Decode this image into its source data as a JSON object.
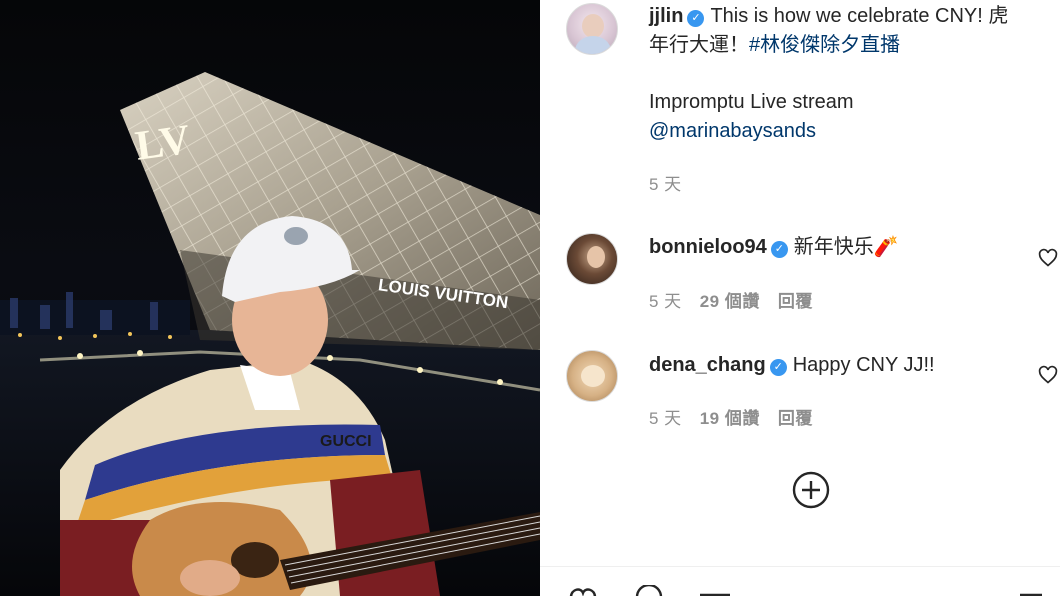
{
  "post": {
    "author": "jjlin",
    "caption_line1": "This is how we celebrate CNY! 虎",
    "caption_line2_text": "年行大運！",
    "caption_hashtag": "#林俊傑除夕直播",
    "caption_line3": "Impromptu Live stream",
    "caption_mention": "@marinabaysands",
    "age": "5 天"
  },
  "photo": {
    "building_sign": "LOUIS VUITTON",
    "jacket_logo": "GUCCI"
  },
  "comments": [
    {
      "username": "bonnieloo94",
      "text": "新年快乐🧨",
      "age": "5 天",
      "likes": "29 個讚",
      "reply": "回覆"
    },
    {
      "username": "dena_chang",
      "text": "Happy CNY JJ!!",
      "age": "5 天",
      "likes": "19 個讚",
      "reply": "回覆"
    }
  ],
  "icons": {
    "verified": "verified-badge-icon",
    "like": "heart-icon",
    "load_more": "plus-circle-icon"
  },
  "colors": {
    "link": "#00376b",
    "verified": "#3897f0",
    "muted": "#8e8e8e"
  }
}
